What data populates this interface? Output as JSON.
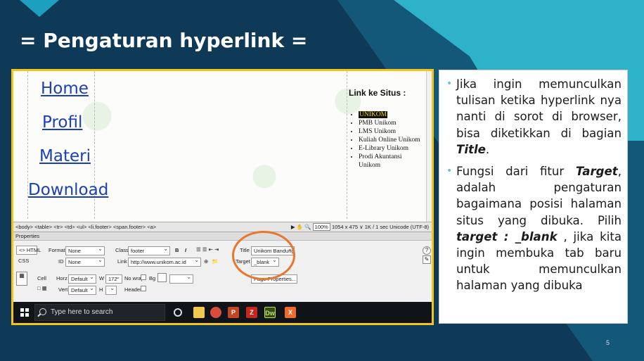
{
  "slide": {
    "title": "= Pengaturan hyperlink =",
    "page_number": "5"
  },
  "design_view": {
    "nav_links": [
      "Home",
      "Profil",
      "Materi",
      "Download"
    ],
    "link_heading": "Link ke Situs :",
    "link_items": [
      "UNIKOM",
      "PMB Unikom",
      "LMS Unikom",
      "Kuliah Online Unikom",
      "E-Library Unikom",
      "Prodi Akuntansi Unikom"
    ]
  },
  "tag_bar": {
    "path": "<body> <table> <tr> <td> <ul> <li.footer> <span.footer> <a>",
    "zoom": "100%",
    "status": "1054 x 475 ∨  1K / 1 sec  Unicode (UTF-8)"
  },
  "properties": {
    "header": "Properties",
    "html_btn": "HTML",
    "css_btn": "CSS",
    "format_label": "Format",
    "format_value": "None",
    "id_label": "ID",
    "id_value": "None",
    "class_label": "Class",
    "class_value": "footer",
    "link_label": "Link",
    "link_value": "http://www.unikom.ac.id",
    "title_label": "Title",
    "title_value": "Unikom Bandung",
    "target_label": "Target",
    "target_value": "_blank",
    "cell_label": "Cell",
    "horz_label": "Horz",
    "horz_value": "Default",
    "w_label": "W",
    "w_value": "172",
    "nowrap_label": "No wrap",
    "bg_label": "Bg",
    "vert_label": "Vert",
    "vert_value": "Default",
    "h_label": "H",
    "header_label": "Header",
    "page_props": "Page Properties..."
  },
  "taskbar": {
    "search_placeholder": "Type here to search",
    "icons": [
      "cortana-icon",
      "file-explorer-icon",
      "chrome-icon",
      "powerpoint-icon",
      "filezilla-icon",
      "dreamweaver-icon",
      "xampp-icon"
    ],
    "dw_label": "Dw"
  },
  "explanation": {
    "p1_before": "Jika ingin memunculkan tulisan ketika  hyperlink nya nanti di sorot di browser, bisa diketikkan di bagian ",
    "p1_em": "Title",
    "p1_after": ".",
    "p2_a": "Fungsi dari fitur ",
    "p2_em1": "Target",
    "p2_b": ", adalah pengaturan bagaimana posisi halaman situs yang dibuka. Pilih ",
    "p2_em2": "target : _blank",
    "p2_c": " , jika kita ingin membuka tab baru untuk memunculkan halaman yang dibuka"
  },
  "colors": {
    "background": "#0f3a57",
    "accent": "#2fb7cf",
    "frame": "#f5c419",
    "highlight_circle": "#e8762d",
    "link": "#1a3fb8"
  }
}
